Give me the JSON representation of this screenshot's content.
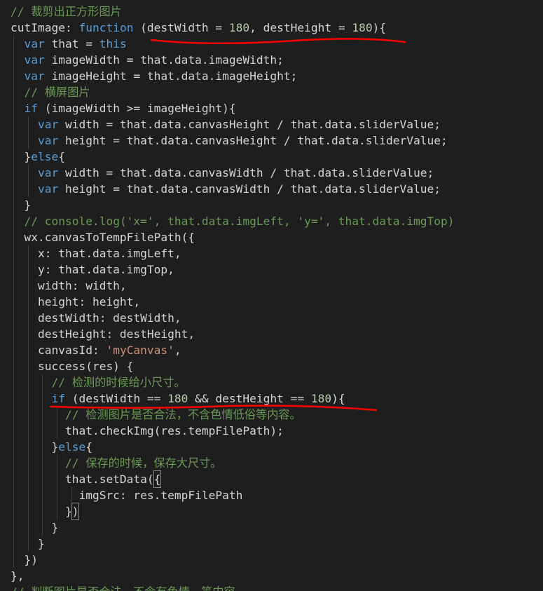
{
  "code_lines": [
    {
      "tokens": [
        {
          "t": "// 裁剪出正方形图片",
          "c": "cm"
        }
      ]
    },
    {
      "tokens": [
        {
          "t": "cutImage: ",
          "c": "id"
        },
        {
          "t": "function",
          "c": "kw"
        },
        {
          "t": " (destWidth = ",
          "c": "id"
        },
        {
          "t": "180",
          "c": "num"
        },
        {
          "t": ", destHeight = ",
          "c": "id"
        },
        {
          "t": "180",
          "c": "num"
        },
        {
          "t": "){",
          "c": "id"
        }
      ]
    },
    {
      "tokens": [
        {
          "t": "  ",
          "c": "id"
        },
        {
          "t": "var",
          "c": "kw"
        },
        {
          "t": " that = ",
          "c": "id"
        },
        {
          "t": "this",
          "c": "kw"
        }
      ]
    },
    {
      "tokens": [
        {
          "t": "  ",
          "c": "id"
        },
        {
          "t": "var",
          "c": "kw"
        },
        {
          "t": " imageWidth = that.data.imageWidth;",
          "c": "id"
        }
      ]
    },
    {
      "tokens": [
        {
          "t": "  ",
          "c": "id"
        },
        {
          "t": "var",
          "c": "kw"
        },
        {
          "t": " imageHeight = that.data.imageHeight;",
          "c": "id"
        }
      ]
    },
    {
      "tokens": [
        {
          "t": "  ",
          "c": "id"
        },
        {
          "t": "// 横屏图片",
          "c": "cm"
        }
      ]
    },
    {
      "tokens": [
        {
          "t": "  ",
          "c": "id"
        },
        {
          "t": "if",
          "c": "kw"
        },
        {
          "t": " (imageWidth >= imageHeight){",
          "c": "id"
        }
      ]
    },
    {
      "tokens": [
        {
          "t": "    ",
          "c": "id"
        },
        {
          "t": "var",
          "c": "kw"
        },
        {
          "t": " width = that.data.canvasHeight / that.data.sliderValue;",
          "c": "id"
        }
      ]
    },
    {
      "tokens": [
        {
          "t": "    ",
          "c": "id"
        },
        {
          "t": "var",
          "c": "kw"
        },
        {
          "t": " height = that.data.canvasHeight / that.data.sliderValue;",
          "c": "id"
        }
      ]
    },
    {
      "tokens": [
        {
          "t": "  }",
          "c": "id"
        },
        {
          "t": "else",
          "c": "kw"
        },
        {
          "t": "{",
          "c": "id"
        }
      ]
    },
    {
      "tokens": [
        {
          "t": "    ",
          "c": "id"
        },
        {
          "t": "var",
          "c": "kw"
        },
        {
          "t": " width = that.data.canvasWidth / that.data.sliderValue;",
          "c": "id"
        }
      ]
    },
    {
      "tokens": [
        {
          "t": "    ",
          "c": "id"
        },
        {
          "t": "var",
          "c": "kw"
        },
        {
          "t": " height = that.data.canvasWidth / that.data.sliderValue;",
          "c": "id"
        }
      ]
    },
    {
      "tokens": [
        {
          "t": "  }",
          "c": "id"
        }
      ]
    },
    {
      "tokens": [
        {
          "t": "  ",
          "c": "id"
        },
        {
          "t": "// console.log('x=', that.data.imgLeft, 'y=', that.data.imgTop)",
          "c": "cm"
        }
      ]
    },
    {
      "tokens": [
        {
          "t": "  wx.canvasToTempFilePath({",
          "c": "id"
        }
      ]
    },
    {
      "tokens": [
        {
          "t": "    x: that.data.imgLeft,",
          "c": "id"
        }
      ]
    },
    {
      "tokens": [
        {
          "t": "    y: that.data.imgTop,",
          "c": "id"
        }
      ]
    },
    {
      "tokens": [
        {
          "t": "    width: width,",
          "c": "id"
        }
      ]
    },
    {
      "tokens": [
        {
          "t": "    height: height,",
          "c": "id"
        }
      ]
    },
    {
      "tokens": [
        {
          "t": "    destWidth: destWidth,",
          "c": "id"
        }
      ]
    },
    {
      "tokens": [
        {
          "t": "    destHeight: destHeight,",
          "c": "id"
        }
      ]
    },
    {
      "tokens": [
        {
          "t": "    canvasId: ",
          "c": "id"
        },
        {
          "t": "'myCanvas'",
          "c": "str"
        },
        {
          "t": ",",
          "c": "id"
        }
      ]
    },
    {
      "tokens": [
        {
          "t": "    success(res) {",
          "c": "id"
        }
      ]
    },
    {
      "tokens": [
        {
          "t": "      ",
          "c": "id"
        },
        {
          "t": "// 检测的时候给小尺寸。",
          "c": "cm"
        }
      ]
    },
    {
      "tokens": [
        {
          "t": "      ",
          "c": "id"
        },
        {
          "t": "if",
          "c": "kw"
        },
        {
          "t": " (destWidth == ",
          "c": "id"
        },
        {
          "t": "180",
          "c": "num"
        },
        {
          "t": " && destHeight == ",
          "c": "id"
        },
        {
          "t": "180",
          "c": "num"
        },
        {
          "t": "){",
          "c": "id"
        }
      ]
    },
    {
      "tokens": [
        {
          "t": "        ",
          "c": "id"
        },
        {
          "t": "// 检测图片是否合法，不含色情低俗等内容。",
          "c": "cm"
        }
      ]
    },
    {
      "tokens": [
        {
          "t": "        that.checkImg(res.tempFilePath);",
          "c": "id"
        }
      ]
    },
    {
      "tokens": [
        {
          "t": "      }",
          "c": "id"
        },
        {
          "t": "else",
          "c": "kw"
        },
        {
          "t": "{",
          "c": "id"
        }
      ]
    },
    {
      "tokens": [
        {
          "t": "        ",
          "c": "id"
        },
        {
          "t": "// 保存的时候，保存大尺寸。",
          "c": "cm"
        }
      ]
    },
    {
      "tokens": [
        {
          "t": "        that.setData(",
          "c": "id"
        },
        {
          "t": "{",
          "c": "id",
          "box": true
        }
      ]
    },
    {
      "tokens": [
        {
          "t": "          imgSrc: res.tempFilePath",
          "c": "id"
        }
      ]
    },
    {
      "tokens": [
        {
          "t": "        }",
          "c": "id"
        },
        {
          "t": ")",
          "c": "id",
          "box": true
        }
      ]
    },
    {
      "tokens": [
        {
          "t": "      }",
          "c": "id"
        }
      ]
    },
    {
      "tokens": [
        {
          "t": "    }",
          "c": "id"
        }
      ]
    },
    {
      "tokens": [
        {
          "t": "  })",
          "c": "id"
        }
      ]
    },
    {
      "tokens": [
        {
          "t": "},",
          "c": "id"
        }
      ]
    },
    {
      "tokens": [
        {
          "t": "// 判断图片是否合法，不含有色情、等内容",
          "c": "cm"
        }
      ]
    }
  ],
  "colors": {
    "background": "#1e1e1e",
    "keyword": "#569cd6",
    "comment": "#6a9955",
    "number": "#b5cea8",
    "string": "#ce9178",
    "text": "#d4d4d4",
    "annotation": "#ff0000"
  }
}
